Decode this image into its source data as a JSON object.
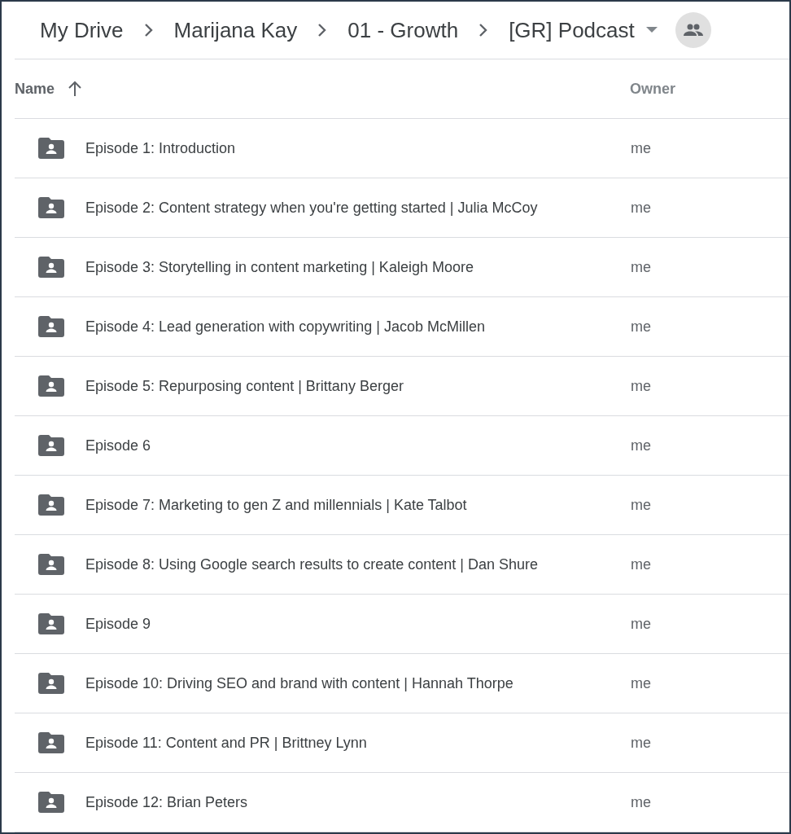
{
  "breadcrumb": [
    "My Drive",
    "Marijana Kay",
    "01 - Growth",
    "[GR] Podcast"
  ],
  "table": {
    "columns": [
      {
        "label": "Name",
        "sorted": true
      },
      {
        "label": "Owner",
        "sorted": false
      }
    ],
    "rows": [
      {
        "name": "Episode 1: Introduction",
        "owner": "me"
      },
      {
        "name": "Episode 2: Content strategy when you're getting started | Julia McCoy",
        "owner": "me"
      },
      {
        "name": "Episode 3: Storytelling in content marketing | Kaleigh Moore",
        "owner": "me"
      },
      {
        "name": "Episode 4: Lead generation with copywriting | Jacob McMillen",
        "owner": "me"
      },
      {
        "name": "Episode 5: Repurposing content | Brittany Berger",
        "owner": "me"
      },
      {
        "name": "Episode 6",
        "owner": "me"
      },
      {
        "name": "Episode 7: Marketing to gen Z and millennials | Kate Talbot",
        "owner": "me"
      },
      {
        "name": "Episode 8: Using Google search results to create content | Dan Shure",
        "owner": "me"
      },
      {
        "name": "Episode 9",
        "owner": "me"
      },
      {
        "name": "Episode 10: Driving SEO and brand with content | Hannah Thorpe",
        "owner": "me"
      },
      {
        "name": "Episode 11: Content and PR | Brittney Lynn",
        "owner": "me"
      },
      {
        "name": "Episode 12: Brian Peters",
        "owner": "me"
      }
    ]
  }
}
